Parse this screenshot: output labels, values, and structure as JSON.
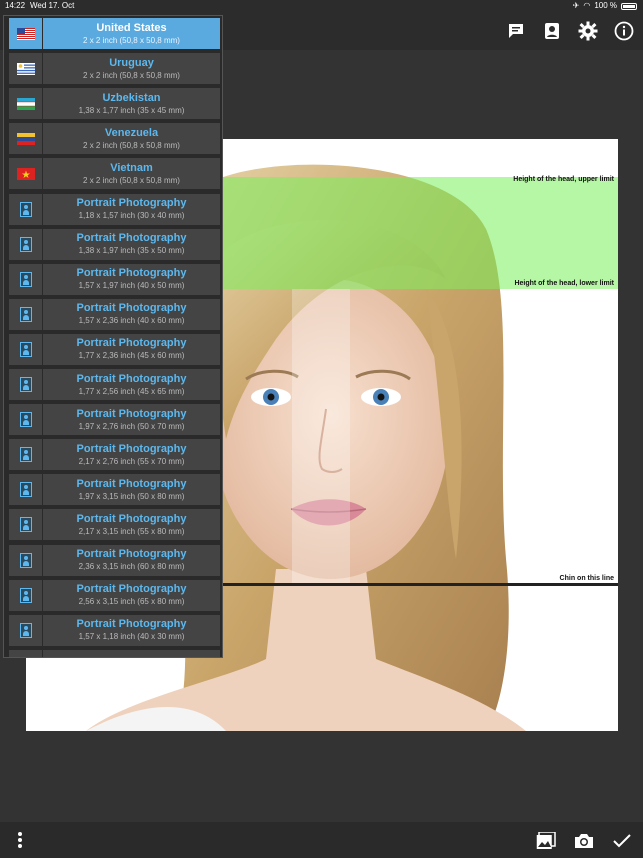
{
  "status": {
    "time": "14:22",
    "date": "Wed 17. Oct",
    "battery": "100 %"
  },
  "guides": {
    "upper": "Height of the head, upper limit",
    "lower": "Height of the head, lower limit",
    "chin": "Chin on this line"
  },
  "icons": {
    "top": [
      "comment-icon",
      "contact-card-icon",
      "gear-icon",
      "info-icon"
    ],
    "bottom_left": "more-vertical-icon",
    "bottom_right": [
      "gallery-icon",
      "camera-icon",
      "checkmark-icon"
    ]
  },
  "list": [
    {
      "name": "United States",
      "size": "2 x 2 inch (50,8 x 50,8 mm)",
      "icon": "us-flag",
      "selected": true
    },
    {
      "name": "Uruguay",
      "size": "2 x 2 inch (50,8 x 50,8 mm)",
      "icon": "uruguay-flag"
    },
    {
      "name": "Uzbekistan",
      "size": "1,38 x 1,77 inch (35 x 45 mm)",
      "icon": "uzbekistan-flag"
    },
    {
      "name": "Venezuela",
      "size": "2 x 2 inch (50,8 x 50,8 mm)",
      "icon": "venezuela-flag"
    },
    {
      "name": "Vietnam",
      "size": "2 x 2 inch (50,8 x 50,8 mm)",
      "icon": "vietnam-flag"
    },
    {
      "name": "Portrait Photography",
      "size": "1,18 x 1,57 inch (30 x 40 mm)",
      "icon": "portrait"
    },
    {
      "name": "Portrait Photography",
      "size": "1,38 x 1,97 inch (35 x 50 mm)",
      "icon": "portrait"
    },
    {
      "name": "Portrait Photography",
      "size": "1,57 x 1,97 inch (40 x 50 mm)",
      "icon": "portrait"
    },
    {
      "name": "Portrait Photography",
      "size": "1,57 x 2,36 inch (40 x 60 mm)",
      "icon": "portrait"
    },
    {
      "name": "Portrait Photography",
      "size": "1,77 x 2,36 inch (45 x 60 mm)",
      "icon": "portrait"
    },
    {
      "name": "Portrait Photography",
      "size": "1,77 x 2,56 inch (45 x 65 mm)",
      "icon": "portrait"
    },
    {
      "name": "Portrait Photography",
      "size": "1,97 x 2,76 inch (50 x 70 mm)",
      "icon": "portrait"
    },
    {
      "name": "Portrait Photography",
      "size": "2,17 x 2,76 inch (55 x 70 mm)",
      "icon": "portrait"
    },
    {
      "name": "Portrait Photography",
      "size": "1,97 x 3,15 inch (50 x 80 mm)",
      "icon": "portrait"
    },
    {
      "name": "Portrait Photography",
      "size": "2,17 x 3,15 inch (55 x 80 mm)",
      "icon": "portrait"
    },
    {
      "name": "Portrait Photography",
      "size": "2,36 x 3,15 inch (60 x 80 mm)",
      "icon": "portrait"
    },
    {
      "name": "Portrait Photography",
      "size": "2,56 x 3,15 inch (65 x 80 mm)",
      "icon": "portrait"
    },
    {
      "name": "Portrait Photography",
      "size": "1,57 x 1,18 inch (40 x 30 mm)",
      "icon": "portrait"
    },
    {
      "name": "Portrait Photography",
      "size": "",
      "icon": "portrait"
    }
  ]
}
